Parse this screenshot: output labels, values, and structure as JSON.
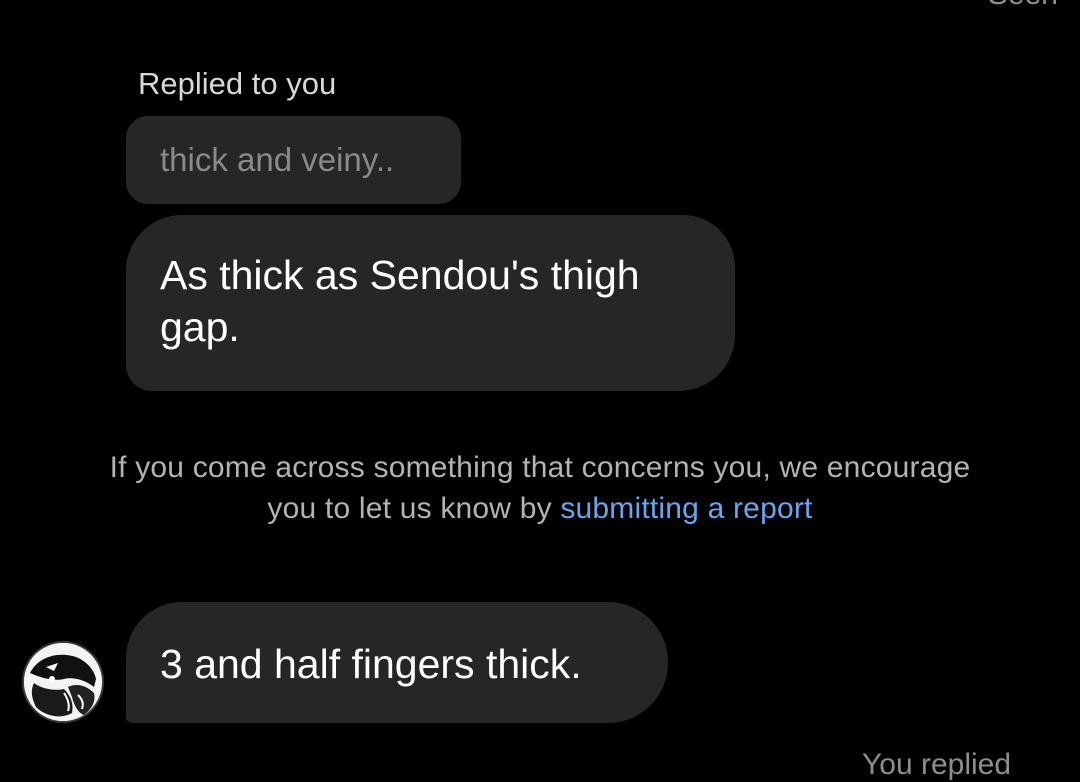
{
  "thread": {
    "top_status": "Seen",
    "reply_context_label": "Replied to you",
    "quoted_message": "thick and veiny..",
    "messages": [
      {
        "text": "As thick as Sendou's thigh gap."
      },
      {
        "text": "3 and half fingers thick."
      }
    ],
    "bottom_status": "You replied"
  },
  "safety_notice": {
    "text_before_link": "If you come across something that concerns you, we encourage you to let us know by ",
    "link_text": "submitting a report"
  },
  "sender": {
    "avatar_icon": "manga-character-avatar"
  },
  "colors": {
    "background": "#000000",
    "bubble": "#262626",
    "link": "#6aa6ec",
    "secondary_text": "#8e8e8e"
  }
}
